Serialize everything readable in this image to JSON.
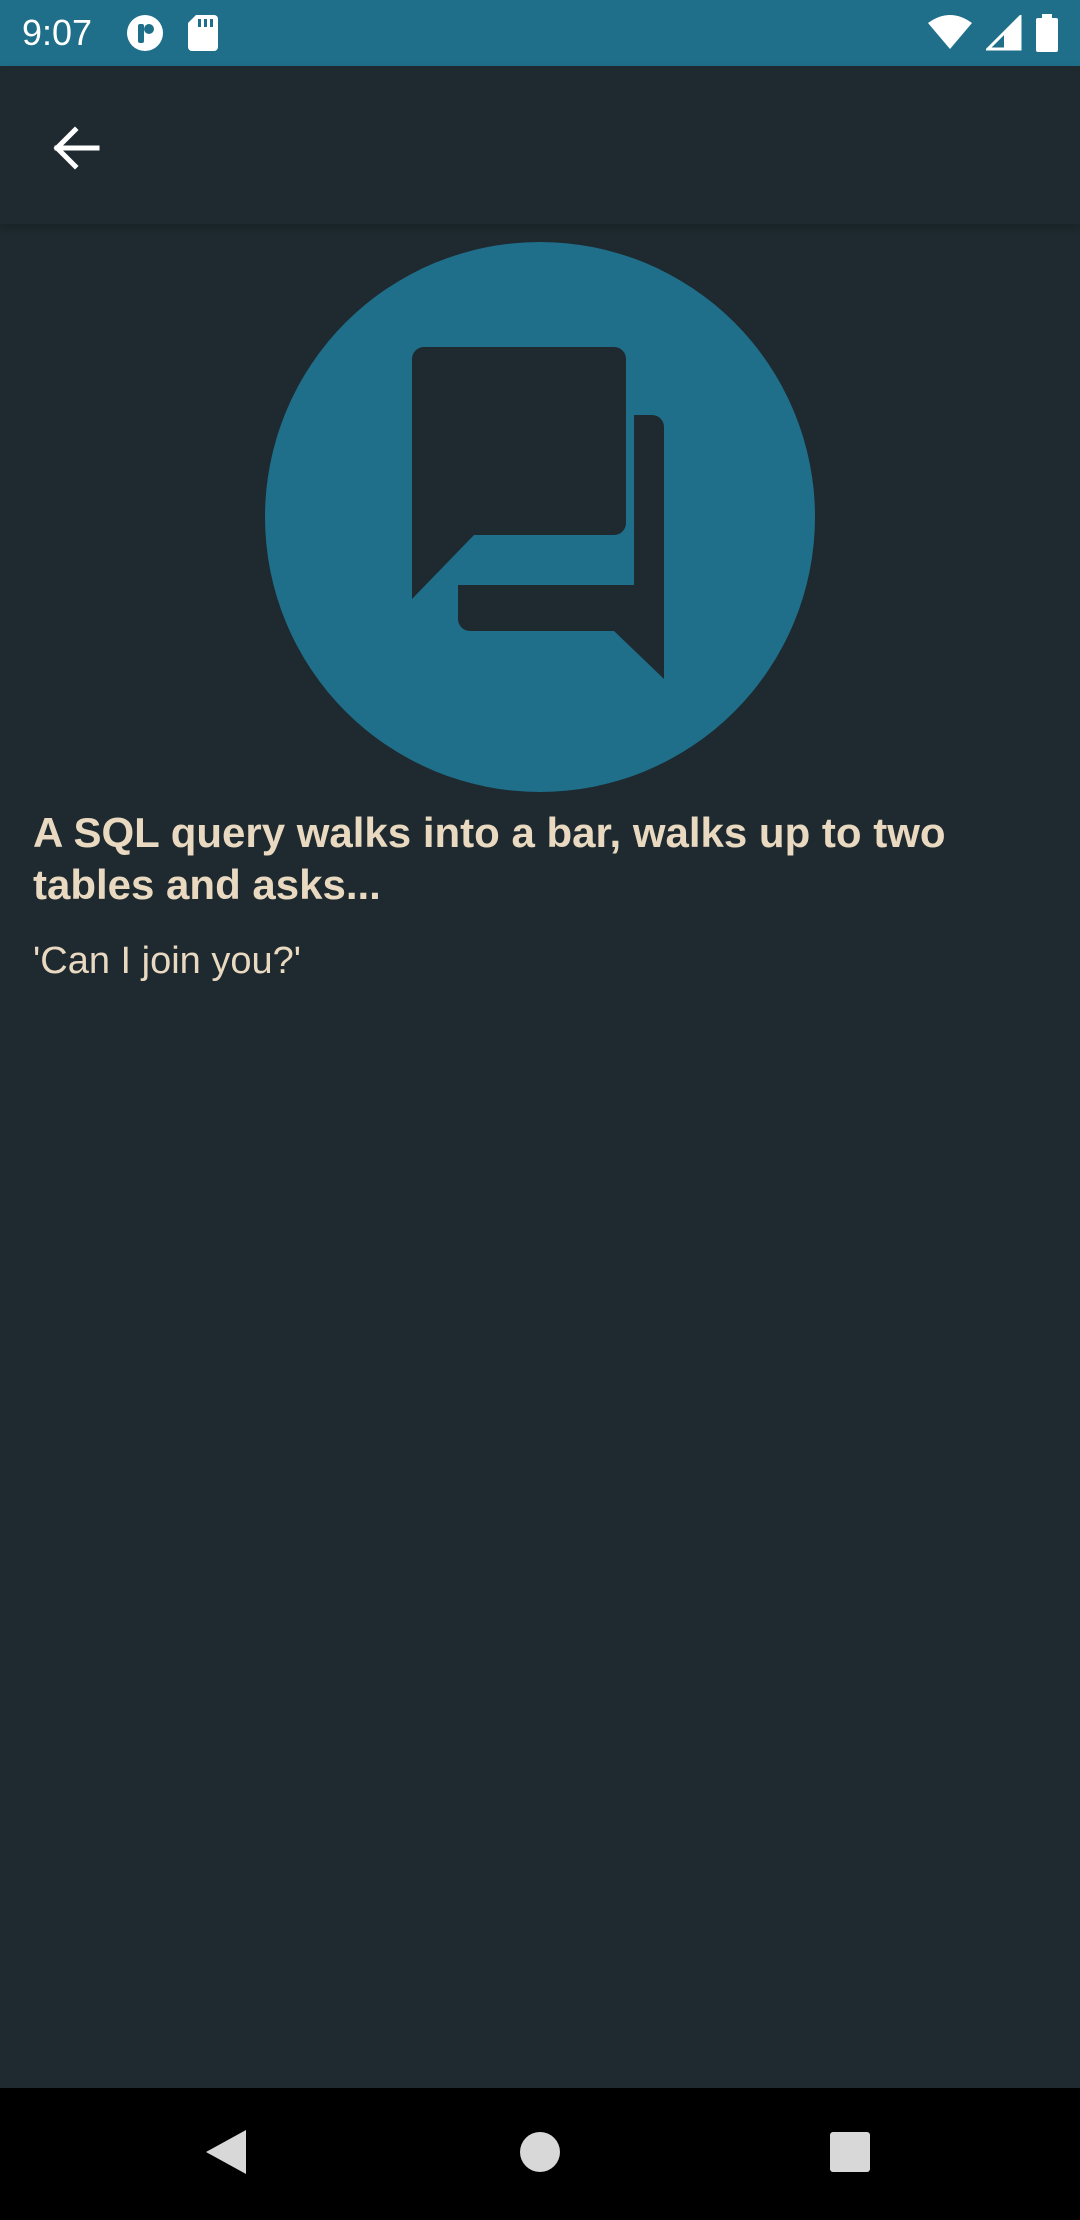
{
  "status_bar": {
    "time": "9:07",
    "color": "#1f6f8b",
    "left_icons": [
      "notification-app-icon",
      "sd-card-icon"
    ],
    "right_icons": [
      "wifi-icon",
      "cellular-signal-icon",
      "battery-icon"
    ]
  },
  "app_bar": {
    "back_icon": "arrow-back-icon"
  },
  "hero": {
    "icon": "chat-bubbles-icon",
    "circle_color": "#1f6f8b"
  },
  "joke": {
    "setup": "A SQL query walks into a bar, walks up to two tables and asks...",
    "punchline": "'Can I join you?'",
    "text_color": "#e9d9c0"
  },
  "nav_bar": {
    "buttons": [
      "back-triangle-icon",
      "home-circle-icon",
      "recents-square-icon"
    ]
  }
}
